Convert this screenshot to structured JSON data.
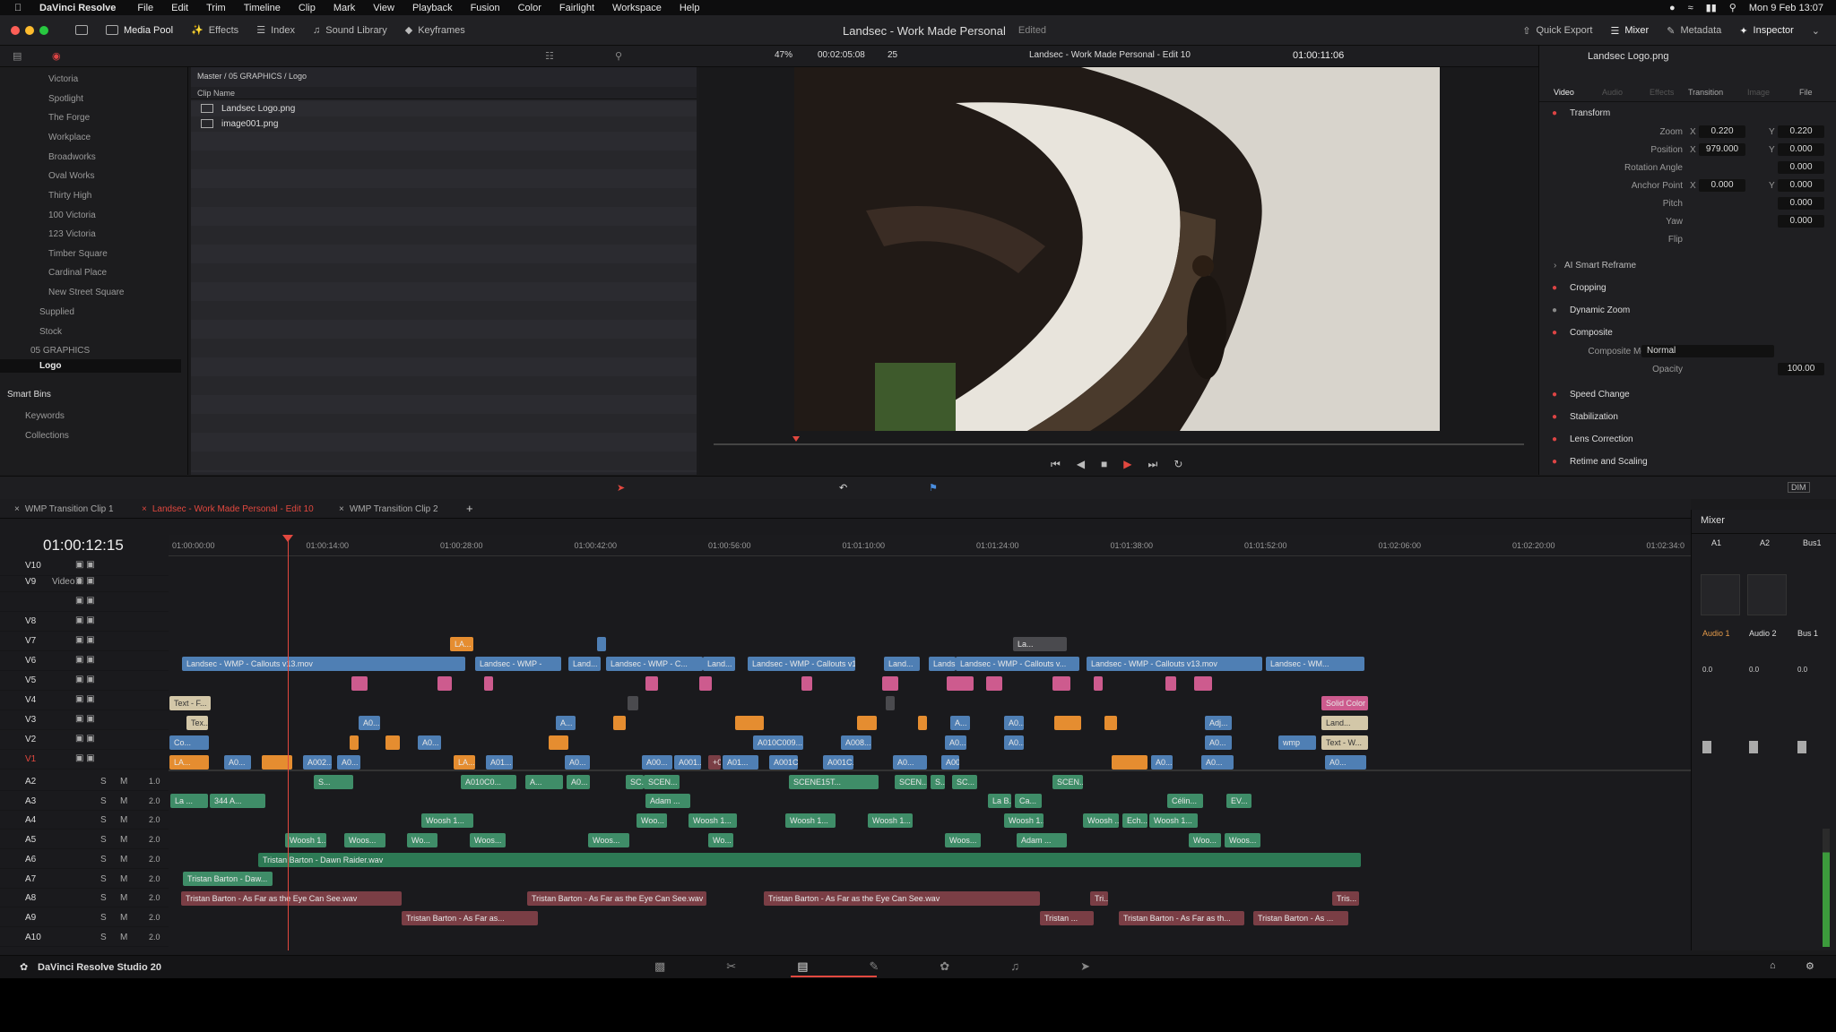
{
  "menubar": {
    "app": "DaVinci Resolve",
    "items": [
      "File",
      "Edit",
      "Trim",
      "Timeline",
      "Clip",
      "Mark",
      "View",
      "Playback",
      "Fusion",
      "Color",
      "Fairlight",
      "Workspace",
      "Help"
    ],
    "clock": "Mon 9 Feb  13:07"
  },
  "toolbar": {
    "media_pool": "Media Pool",
    "effects": "Effects",
    "index": "Index",
    "sound_library": "Sound Library",
    "keyframes": "Keyframes",
    "project_title": "Landsec - Work Made Personal",
    "project_status": "Edited",
    "quick_export": "Quick Export",
    "mixer": "Mixer",
    "metadata": "Metadata",
    "inspector": "Inspector"
  },
  "viewer": {
    "zoom": "47%",
    "duration": "00:02:05:08",
    "fps": "25",
    "timeline_name": "Landsec - Work Made Personal - Edit 10",
    "timecode": "01:00:11:06"
  },
  "bins": {
    "items": [
      "Victoria",
      "Spotlight",
      "The Forge",
      "Workplace",
      "Broadworks",
      "Oval Works",
      "Thirty High",
      "100 Victoria",
      "123 Victoria",
      "Timber Square",
      "Cardinal Place",
      "New Street Square",
      "Supplied",
      "Stock",
      "05 GRAPHICS",
      "Logo"
    ],
    "smart_bins": "Smart Bins",
    "keywords": "Keywords",
    "collections": "Collections"
  },
  "pool": {
    "breadcrumb": "Master / 05 GRAPHICS / Logo",
    "column": "Clip Name",
    "clips": [
      "Landsec Logo.png",
      "image001.png"
    ]
  },
  "inspector": {
    "title": "Landsec Logo.png",
    "tabs": [
      "Video",
      "Audio",
      "Effects",
      "Transition",
      "Image",
      "File"
    ],
    "transform": "Transform",
    "zoom_label": "Zoom",
    "zoom_x": "0.220",
    "zoom_y": "0.220",
    "position_label": "Position",
    "pos_x": "979.000",
    "pos_y": "0.000",
    "rotation_label": "Rotation Angle",
    "rotation": "0.000",
    "anchor_label": "Anchor Point",
    "anchor_x": "0.000",
    "anchor_y": "0.000",
    "pitch_label": "Pitch",
    "pitch": "0.000",
    "yaw_label": "Yaw",
    "yaw": "0.000",
    "flip_label": "Flip",
    "ai_reframe": "AI Smart Reframe",
    "cropping": "Cropping",
    "dynamic_zoom": "Dynamic Zoom",
    "composite": "Composite",
    "composite_mode_label": "Composite Mode",
    "composite_mode": "Normal",
    "opacity_label": "Opacity",
    "opacity": "100.00",
    "speed_change": "Speed Change",
    "stabilization": "Stabilization",
    "lens_correction": "Lens Correction",
    "retime": "Retime and Scaling",
    "x": "X",
    "y": "Y"
  },
  "timeline": {
    "tabs": [
      "WMP Transition Clip 1",
      "Landsec - Work Made Personal - Edit 10",
      "WMP Transition Clip 2"
    ],
    "timecode": "01:00:12:15",
    "ruler": [
      "01:00:00:00",
      "01:00:14:00",
      "01:00:28:00",
      "01:00:42:00",
      "01:00:56:00",
      "01:01:10:00",
      "01:01:24:00",
      "01:01:38:00",
      "01:01:52:00",
      "01:02:06:00",
      "01:02:20:00",
      "01:02:34:0"
    ],
    "video_tracks": [
      "V10",
      "V9",
      "",
      "V8",
      "V7",
      "V6",
      "V5",
      "V4",
      "V3",
      "V2",
      "V1"
    ],
    "v9_name": "Video 9",
    "audio_tracks": [
      "A2",
      "A3",
      "A4",
      "A5",
      "A6",
      "A7",
      "A8",
      "A9",
      "A10"
    ],
    "audio_levels": [
      "1.0",
      "2.0",
      "2.0",
      "2.0",
      "2.0",
      "2.0",
      "2.0",
      "2.0",
      "2.0"
    ],
    "s": "S",
    "m": "M"
  },
  "clips": {
    "v6": [
      "Landsec - WMP - Callouts v13.mov",
      "Landsec - WMP -",
      "Land...",
      "Landsec - WMP - C...",
      "Land...",
      "Landsec - WMP - Callouts v1...",
      "Land...",
      "Lands...",
      "Landsec - WMP - Callouts v...",
      "Landsec - WMP - Callouts v13.mov",
      "Landsec - WM..."
    ],
    "v7": [
      "LA...",
      "La..."
    ],
    "v4": [
      "Text - F...",
      "Solid Color"
    ],
    "v3": [
      "Tex...",
      "A0...",
      "A...",
      "A...",
      "A0...",
      "Adj...",
      "Land..."
    ],
    "v2": [
      "Co...",
      "A0...",
      "A010C009...",
      "A008...",
      "A0...",
      "A0...",
      "A0...",
      "wmp",
      "Text - W..."
    ],
    "v1": [
      "LA...",
      "A0...",
      "A002...",
      "A0...",
      "LA...",
      "A01...",
      "A0...",
      "A00...",
      "A001...",
      "+00:17",
      "A01...",
      "A001C00...",
      "A001C...",
      "A0...",
      "A00...",
      "A0...",
      "A0...",
      "A0..."
    ],
    "a2": [
      "S...",
      "A010C0...",
      "A...",
      "A0...",
      "SC...",
      "SCEN...",
      "SCENE15T...",
      "SCEN...",
      "S...",
      "SC...",
      "SCEN..."
    ],
    "a3": [
      "La ...",
      "344 A...",
      "Adam ...",
      "La B...",
      "Ca...",
      "Célin...",
      "EV..."
    ],
    "a4": [
      "Woosh 1...",
      "Woo...",
      "Woosh 1...",
      "Woosh 1...",
      "Woosh 1...",
      "Woosh 1...",
      "Woosh ...",
      "Ech...",
      "Woosh 1..."
    ],
    "a5": [
      "Woosh 1...",
      "Woos...",
      "Wo...",
      "Woos...",
      "Woos...",
      "Wo...",
      "Woos...",
      "Adam ...",
      "Woo...",
      "Woos..."
    ],
    "a6": [
      "Tristan Barton - Dawn Raider.wav"
    ],
    "a7": [
      "Tristan Barton - Daw..."
    ],
    "a8": [
      "Tristan Barton - As Far as the Eye Can See.wav",
      "Tristan Barton - As Far as the Eye Can See.wav",
      "Tristan Barton - As Far as the Eye Can See.wav",
      "Tri...",
      "Tris..."
    ],
    "a9": [
      "Tristan Barton - As Far as...",
      "Tristan ...",
      "Tristan Barton - As Far as th...",
      "Tristan Barton - As ..."
    ]
  },
  "mixer": {
    "title": "Mixer",
    "channels": [
      "A1",
      "A2",
      "Bus1"
    ],
    "ch_names": [
      "Audio 1",
      "Audio 2",
      "Bus 1"
    ],
    "levels": [
      "0.0",
      "0.0",
      "0.0"
    ],
    "dim": "DIM"
  },
  "footer": {
    "brand": "DaVinci Resolve Studio 20"
  },
  "colors": {
    "accent": "#e2483f",
    "playhead": "#e2483f",
    "video_clip": "#4f7fb4",
    "audio_clip": "#3f8d68"
  }
}
